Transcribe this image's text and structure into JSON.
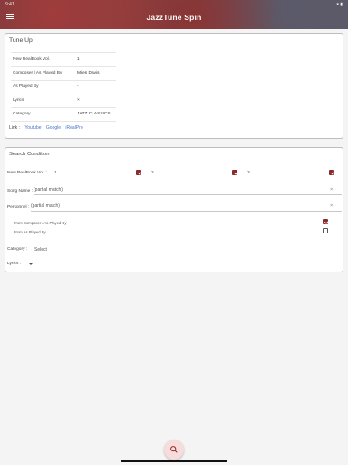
{
  "status_bar": {
    "time": "9:41",
    "icons": "▾ ▮"
  },
  "app": {
    "title": "JazzTune Spin"
  },
  "tune_up": {
    "title": "Tune Up",
    "rows": [
      {
        "label": "New RealBook Vol.",
        "value": "1"
      },
      {
        "label": "Composer | As Played By",
        "value": "Miles Davis"
      },
      {
        "label": "As Played By",
        "value": "-"
      },
      {
        "label": "Lyrics",
        "value": "×"
      },
      {
        "label": "Category",
        "value": "JAZZ CLASSICS"
      }
    ],
    "link_label": "Link :",
    "links": [
      "Youtube",
      "Google",
      "iRealPro"
    ]
  },
  "search": {
    "title": "Search Condition",
    "vol_label": "New RealBook Vol. :",
    "vols": [
      {
        "num": "1",
        "checked": true
      },
      {
        "num": "2",
        "checked": true
      },
      {
        "num": "3",
        "checked": true
      }
    ],
    "song_label": "Song Name :",
    "song_placeholder": "(partial match)",
    "personnel_label": "Personnel :",
    "personnel_placeholder": "(partial match)",
    "from_composer": {
      "label": "From Composer / As Played By",
      "checked": true
    },
    "from_played": {
      "label": "From As Played By",
      "checked": false
    },
    "category_label": "Category :",
    "category_value": "Select",
    "lyrics_label": "Lyrics :",
    "lyrics_value": ""
  },
  "colors": {
    "accent": "#8b2a2a",
    "link": "#4a73c9",
    "fab": "#f7dcdc",
    "header": "#8f3f3f"
  },
  "icons": {
    "menu": "menu-icon",
    "clear": "clear-icon",
    "fab": "search-icon"
  }
}
